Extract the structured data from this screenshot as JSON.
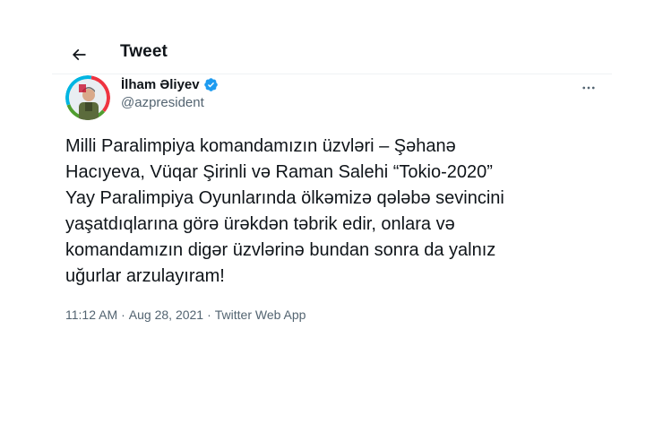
{
  "header": {
    "title": "Tweet"
  },
  "tweet": {
    "author": {
      "display_name": "İlham Əliyev",
      "handle": "@azpresident"
    },
    "text": "Milli Paralimpiya komandamızın üzvləri – Şəhanə\nHacıyeva, Vüqar Şirinli və Raman Salehi “Tokio-2020”\nYay Paralimpiya Oyunlarında ölkəmizə qələbə sevincini\nyaşatdıqlarına görə ürəkdən təbrik edir, onlara və\nkomandamızın digər üzvlərinə bundan sonra da yalnız\nuğurlar arzulayıram!",
    "time": "11:12 AM",
    "separator": "·",
    "date": "Aug 28, 2021",
    "source": "Twitter Web App"
  },
  "colors": {
    "text_primary": "#0f1419",
    "text_secondary": "#536471",
    "verified_blue": "#1d9bf0",
    "divider": "#eff3f4"
  },
  "icons": {
    "back": "arrow-left-icon",
    "verified": "verified-badge-icon",
    "more": "more-horizontal-icon"
  }
}
